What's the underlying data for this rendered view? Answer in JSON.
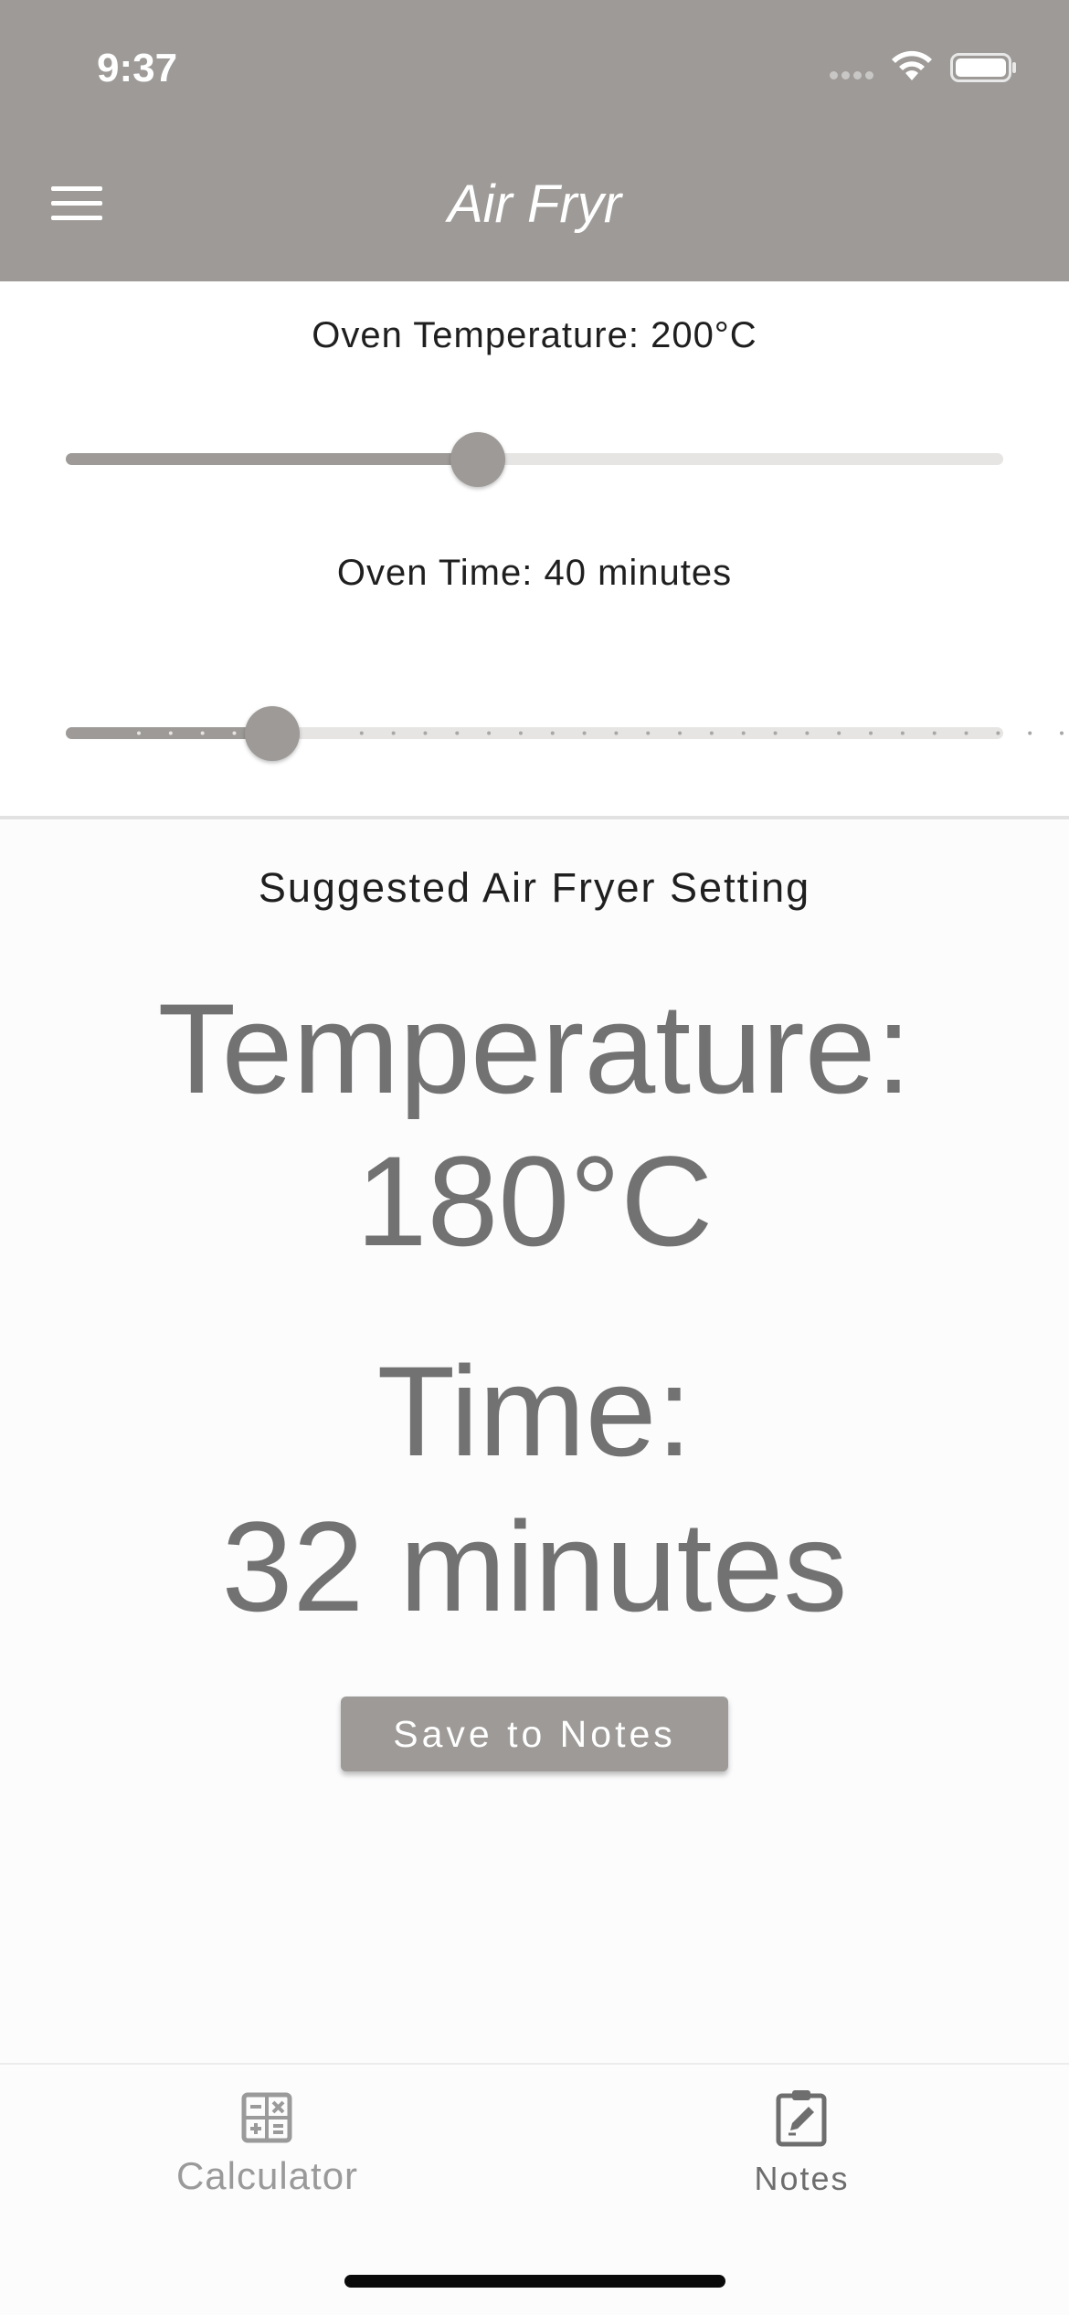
{
  "status_bar": {
    "time": "9:37"
  },
  "header": {
    "title": "Air Fryr",
    "menu_icon": "hamburger-icon"
  },
  "inputs": {
    "oven_temperature_label": "Oven Temperature: 200°C",
    "oven_temperature_value": 200,
    "oven_temperature_slider_fraction": 0.44,
    "oven_time_label": "Oven Time: 40 minutes",
    "oven_time_value": 40,
    "oven_time_slider_fraction": 0.22
  },
  "result": {
    "heading": "Suggested Air Fryer Setting",
    "temperature_label": "Temperature:",
    "temperature_value": "180°C",
    "time_label": "Time:",
    "time_value": "32 minutes"
  },
  "actions": {
    "save_label": "Save to Notes"
  },
  "tabs": [
    {
      "label": "Calculator",
      "icon": "calculator-icon",
      "active": true
    },
    {
      "label": "Notes",
      "icon": "clipboard-edit-icon",
      "active": false
    }
  ],
  "colors": {
    "accent": "#9d9a97",
    "text_primary": "#1f1f1f",
    "text_result": "#727272",
    "track": "#e6e5e4"
  }
}
